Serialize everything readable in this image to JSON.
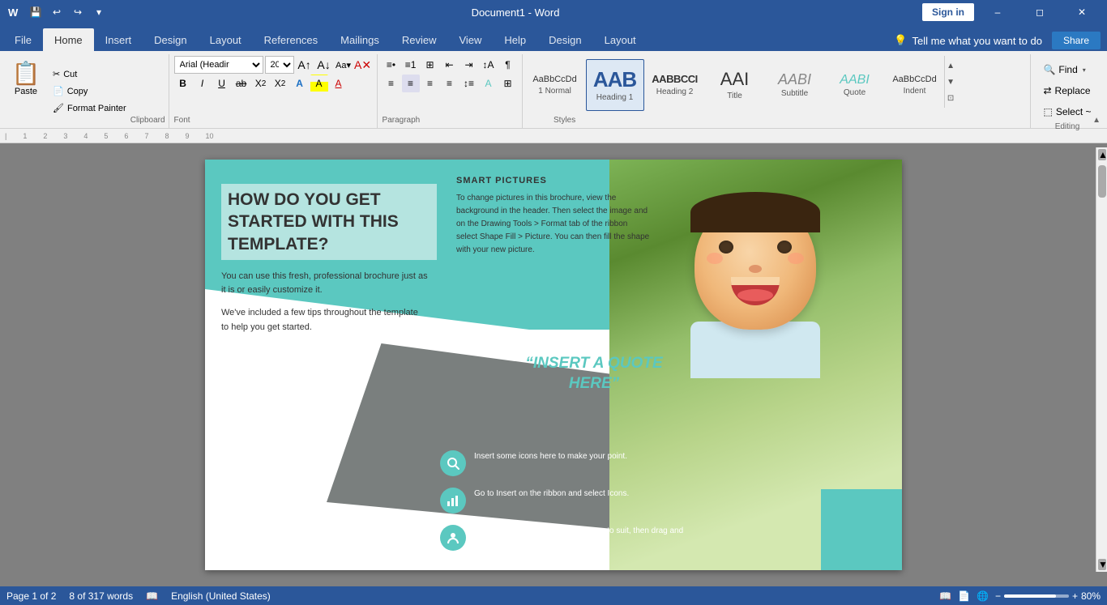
{
  "titlebar": {
    "title": "Document1 - Word",
    "app": "Word",
    "sign_in": "Sign in",
    "save_icon": "💾",
    "undo_icon": "↩",
    "redo_icon": "↪"
  },
  "tabs": {
    "items": [
      "File",
      "Home",
      "Insert",
      "Design",
      "Layout",
      "References",
      "Mailings",
      "Review",
      "View",
      "Help",
      "Design",
      "Layout"
    ],
    "active": "Home",
    "tell_me": "Tell me what you want to do",
    "share": "Share"
  },
  "ribbon": {
    "clipboard": {
      "label": "Clipboard",
      "paste_label": "Paste",
      "cut_label": "Cut",
      "copy_label": "Copy",
      "format_painter_label": "Format Painter"
    },
    "font": {
      "label": "Font",
      "font_name": "Arial (Headir",
      "font_size": "20",
      "bold": "B",
      "italic": "I",
      "underline": "U",
      "strikethrough": "ab",
      "subscript": "X₂",
      "superscript": "X²"
    },
    "paragraph": {
      "label": "Paragraph"
    },
    "styles": {
      "label": "Styles",
      "items": [
        {
          "name": "1 Normal",
          "preview": "AaBbCcDd",
          "style": "normal"
        },
        {
          "name": "Heading 1",
          "preview": "AAB",
          "style": "h1"
        },
        {
          "name": "Heading 2",
          "preview": "AABBCCI",
          "style": "h2"
        },
        {
          "name": "Title",
          "preview": "AAI",
          "style": "title"
        },
        {
          "name": "Subtitle",
          "preview": "AABI",
          "style": "subtitle"
        },
        {
          "name": "Quote",
          "preview": "AABI",
          "style": "quote"
        },
        {
          "name": "Indent",
          "preview": "AaBbCcDd",
          "style": "indent"
        }
      ]
    },
    "editing": {
      "label": "Editing",
      "find_label": "Find",
      "replace_label": "Replace",
      "select_label": "Select ~"
    }
  },
  "document": {
    "heading": "HOW DO YOU GET STARTED WITH THIS TEMPLATE?",
    "body1": "You can use this fresh, professional brochure just as it is or easily customize it.",
    "body2": "We've included a few tips throughout the template to help you get started.",
    "smart_pictures_title": "SMART PICTURES",
    "smart_pictures_text": "To change pictures in this brochure, view the background in the header. Then select the image and on the Drawing Tools > Format tab of the ribbon select Shape Fill > Picture. You can then fill the shape with your new picture.",
    "quote": "“INSERT A QUOTE HERE”",
    "icon_items": [
      {
        "text": "Insert some icons here to make your point."
      },
      {
        "text": "Go to Insert on the ribbon and select Icons."
      },
      {
        "text": "You can change the color of the icon to suit, then drag and drop it in place."
      }
    ]
  },
  "statusbar": {
    "page": "Page 1 of 2",
    "words": "8 of 317 words",
    "language": "English (United States)",
    "zoom": "80%"
  }
}
